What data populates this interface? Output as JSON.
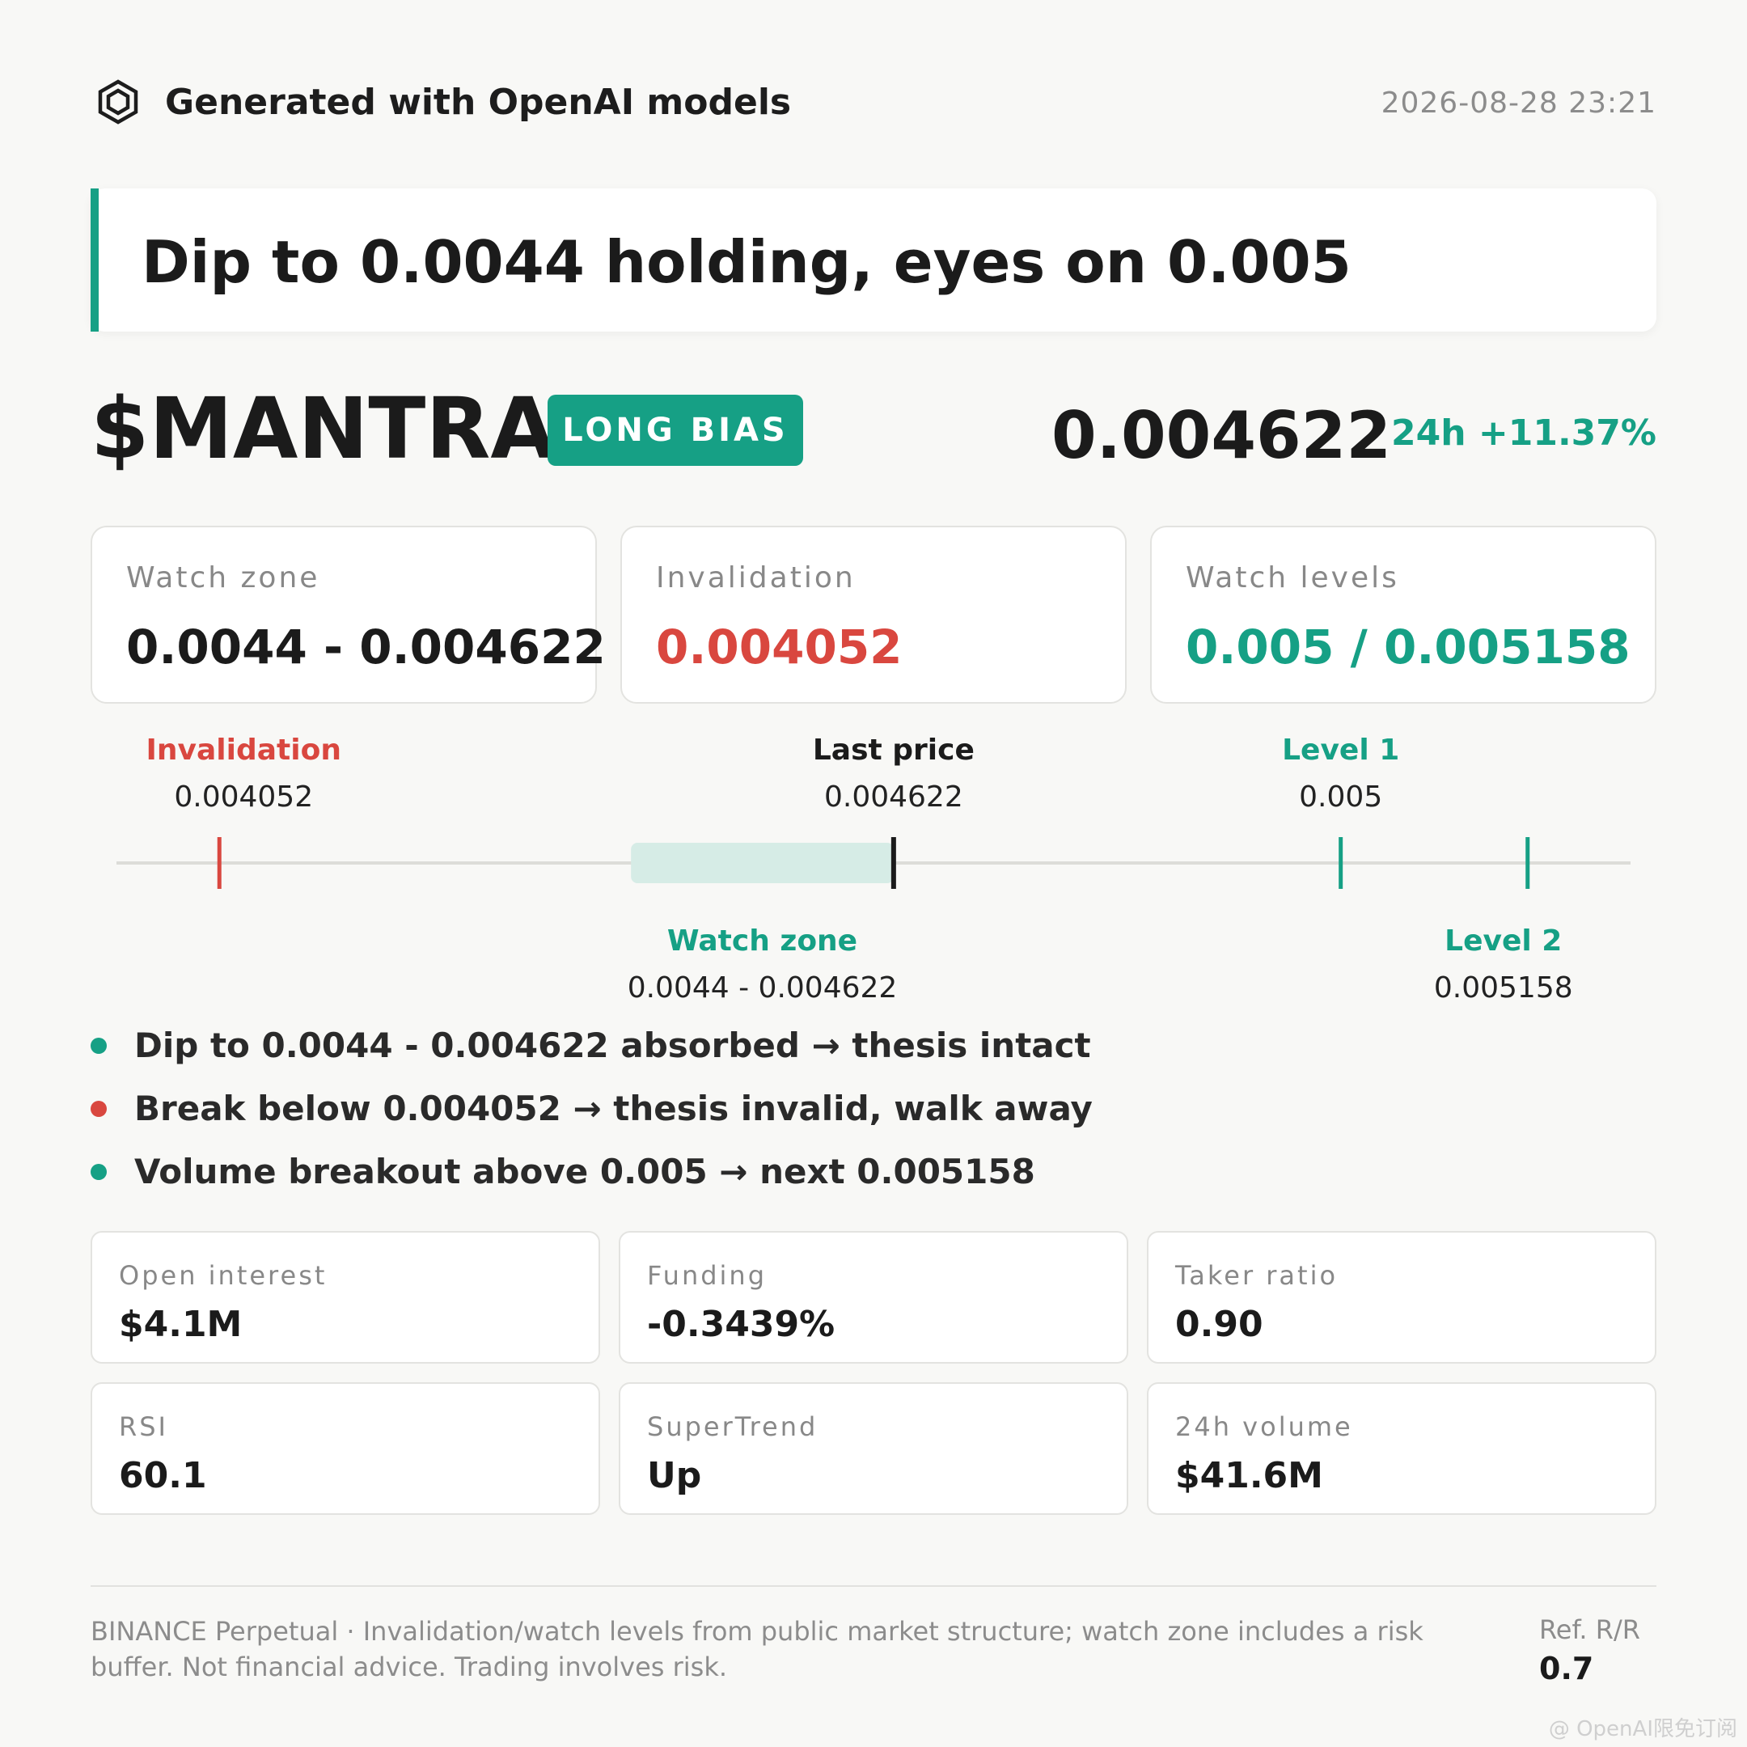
{
  "header": {
    "brand_icon": "hexagon-logo-icon",
    "brand_text": "Generated with OpenAI models",
    "timestamp": "2026-08-28 23:21"
  },
  "headline": "Dip to 0.0044 holding, eyes on 0.005",
  "ticker": {
    "symbol": "$MANTRA",
    "bias_badge": "LONG BIAS",
    "last_price": "0.004622",
    "change_24h": "24h +11.37%"
  },
  "summary_cards": [
    {
      "label": "Watch zone",
      "value": "0.0044 - 0.004622",
      "color": "#1b1b1b"
    },
    {
      "label": "Invalidation",
      "value": "0.004052",
      "color": "#d9473f"
    },
    {
      "label": "Watch levels",
      "value": "0.005 / 0.005158",
      "color": "#16a085"
    }
  ],
  "range_chart": {
    "min": 0.003965,
    "max": 0.005245,
    "invalidation": {
      "label": "Invalidation",
      "value_text": "0.004052",
      "value": 0.004052
    },
    "last_price": {
      "label": "Last price",
      "value_text": "0.004622",
      "value": 0.004622
    },
    "level1": {
      "label": "Level 1",
      "value_text": "0.005",
      "value": 0.005
    },
    "level2": {
      "label": "Level 2",
      "value_text": "0.005158",
      "value": 0.005158
    },
    "watch_zone": {
      "label": "Watch zone",
      "value_text": "0.0044 - 0.004622",
      "low": 0.0044,
      "high": 0.004622
    }
  },
  "bullets": [
    {
      "text": "Dip to 0.0044 - 0.004622 absorbed → thesis intact",
      "color": "#16a085"
    },
    {
      "text": "Break below 0.004052 → thesis invalid, walk away",
      "color": "#d9473f"
    },
    {
      "text": "Volume breakout above 0.005 → next 0.005158",
      "color": "#16a085"
    }
  ],
  "metrics": [
    {
      "label": "Open interest",
      "value": "$4.1M"
    },
    {
      "label": "Funding",
      "value": "-0.3439%"
    },
    {
      "label": "Taker ratio",
      "value": "0.90"
    },
    {
      "label": "RSI",
      "value": "60.1"
    },
    {
      "label": "SuperTrend",
      "value": "Up"
    },
    {
      "label": "24h volume",
      "value": "$41.6M"
    }
  ],
  "footer": {
    "note": "BINANCE Perpetual · Invalidation/watch levels from public market structure; watch zone includes a risk buffer. Not financial advice. Trading involves risk.",
    "rr_label": "Ref. R/R",
    "rr_value": "0.7",
    "watermark": "@ OpenAI限免订阅"
  },
  "colors": {
    "accent_green": "#16a085",
    "accent_red": "#d9473f",
    "zone_fill": "#d6ece6"
  }
}
